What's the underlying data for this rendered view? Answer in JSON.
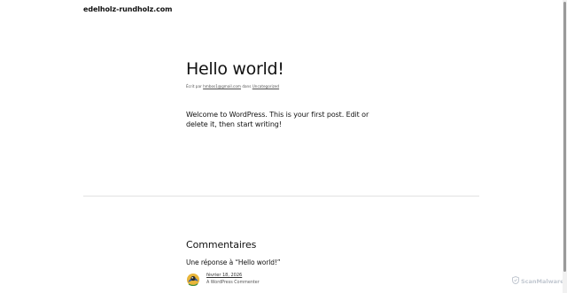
{
  "site": {
    "title": "edelholz-rundholz.com"
  },
  "post": {
    "title": "Hello world!",
    "meta_prefix": "Écrit par ",
    "author": "hmbos1@gmail.com",
    "meta_middle": " dans ",
    "category": "Uncategorized",
    "content": "Welcome to WordPress. This is your first post. Edit or delete it, then start writing!"
  },
  "comments": {
    "heading": "Commentaires",
    "count_text": "Une réponse à “Hello world!”",
    "items": [
      {
        "date": "février 18, 2026",
        "author": "A WordPress Commenter",
        "avatar_icon": "wordpress-avatar-icon"
      }
    ]
  },
  "watermark": {
    "text": "ScanMalware",
    "icon": "shield-icon"
  },
  "colors": {
    "text": "#111111",
    "meta": "#555555",
    "separator": "#e2e2e2",
    "watermark": "#c2c8d1"
  }
}
